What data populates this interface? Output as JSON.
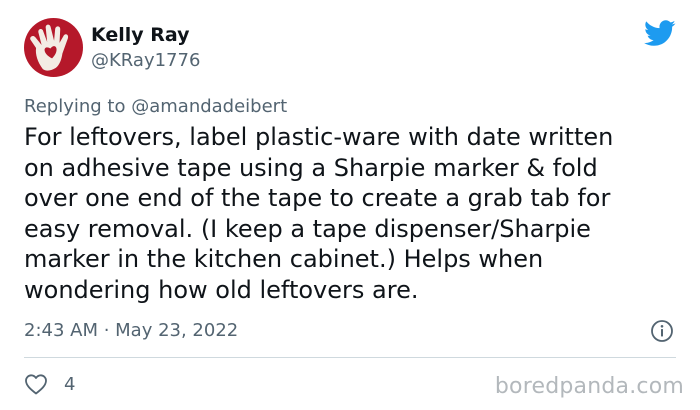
{
  "author": {
    "display_name": "Kelly Ray",
    "handle": "@KRay1776",
    "avatar_icon": "hand-heart-avatar"
  },
  "brand": {
    "icon": "twitter-bird-icon",
    "color": "#1d9bf0"
  },
  "reply": {
    "prefix": "Replying to",
    "mention": "@amandadeibert"
  },
  "tweet": {
    "lines": [
      "For leftovers, label plastic-ware with date written",
      "on adhesive tape using a Sharpie marker & fold",
      "over one end of the tape to create a grab tab for",
      "easy removal. (I keep a tape dispenser/Sharpie",
      "marker in the kitchen cabinet.) Helps when",
      "wondering how old leftovers are."
    ],
    "timestamp": "2:43 AM · May 23, 2022"
  },
  "actions": {
    "like_icon": "heart-outline-icon",
    "like_count": "4",
    "info_icon": "info-icon"
  },
  "watermark": "boredpanda.com"
}
